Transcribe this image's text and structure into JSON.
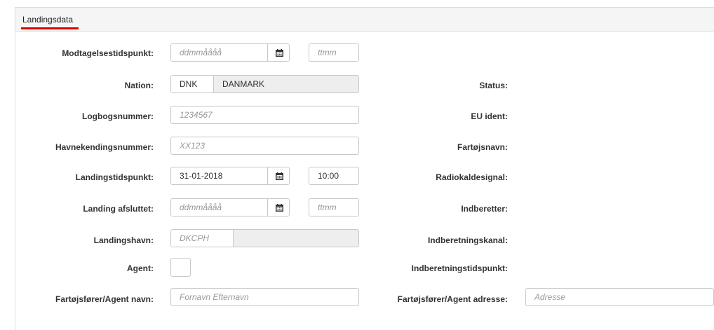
{
  "header": {
    "tab_label": "Landingsdata"
  },
  "left": {
    "modtagelse": {
      "label": "Modtagelsestidspunkt:",
      "date_placeholder": "ddmmåååå",
      "time_placeholder": "ttmm"
    },
    "nation": {
      "label": "Nation:",
      "code": "DNK",
      "name": "DANMARK"
    },
    "logbog": {
      "label": "Logbogsnummer:",
      "placeholder": "1234567"
    },
    "havne": {
      "label": "Havnekendingsnummer:",
      "placeholder": "XX123"
    },
    "landingstid": {
      "label": "Landingstidspunkt:",
      "date_value": "31-01-2018",
      "time_value": "10:00"
    },
    "afsluttet": {
      "label": "Landing afsluttet:",
      "date_placeholder": "ddmmåååå",
      "time_placeholder": "ttmm"
    },
    "landingshavn": {
      "label": "Landingshavn:",
      "placeholder": "DKCPH"
    },
    "agent": {
      "label": "Agent:"
    },
    "foerer_navn": {
      "label": "Fartøjsfører/Agent navn:",
      "placeholder": "Fornavn Efternavn"
    }
  },
  "right": {
    "status": "Status:",
    "eu_ident": "EU ident:",
    "fartoejsnavn": "Fartøjsnavn:",
    "radiokaldesignal": "Radiokaldesignal:",
    "indberetter": "Indberetter:",
    "indberetningskanal": "Indberetningskanal:",
    "indberetningstidspunkt": "Indberetningstidspunkt:",
    "foerer_adresse": {
      "label": "Fartøjsfører/Agent adresse:",
      "placeholder": "Adresse"
    }
  },
  "icons": {
    "calendar": "calendar-icon"
  }
}
